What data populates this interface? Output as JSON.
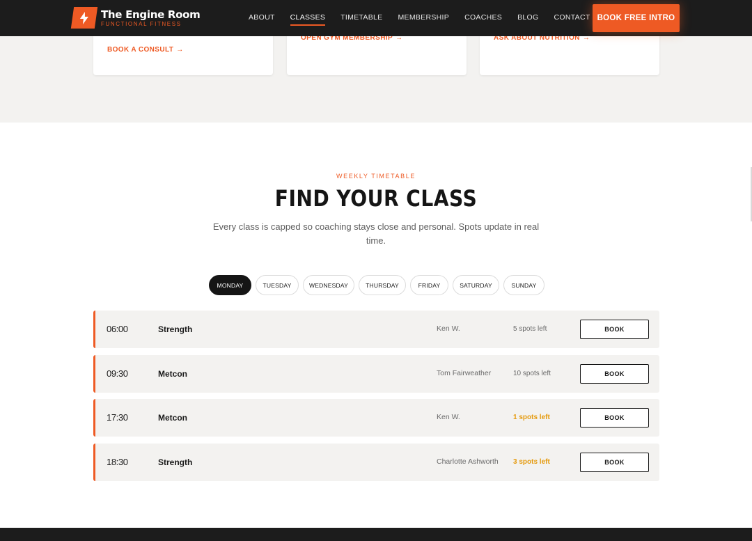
{
  "brand": {
    "name": "The Engine Room",
    "tagline": "FUNCTIONAL FITNESS",
    "accent_color": "#ee5a24"
  },
  "nav": {
    "items": [
      {
        "label": "ABOUT",
        "active": false
      },
      {
        "label": "CLASSES",
        "active": true
      },
      {
        "label": "TIMETABLE",
        "active": false
      },
      {
        "label": "MEMBERSHIP",
        "active": false
      },
      {
        "label": "COACHES",
        "active": false
      },
      {
        "label": "BLOG",
        "active": false
      },
      {
        "label": "CONTACT",
        "active": false
      }
    ],
    "cta_label": "BOOK FREE INTRO"
  },
  "cards": [
    {
      "link_label": "BOOK A CONSULT"
    },
    {
      "link_label": "OPEN GYM MEMBERSHIP"
    },
    {
      "link_label": "ASK ABOUT NUTRITION"
    }
  ],
  "timetable": {
    "eyebrow": "WEEKLY TIMETABLE",
    "title": "FIND YOUR CLASS",
    "subtitle": "Every class is capped so coaching stays close and personal. Spots update in real time.",
    "days": [
      "MONDAY",
      "TUESDAY",
      "WEDNESDAY",
      "THURSDAY",
      "FRIDAY",
      "SATURDAY",
      "SUNDAY"
    ],
    "selected_day": "MONDAY",
    "sessions": [
      {
        "time": "06:00",
        "class": "Strength",
        "coach": "Ken W.",
        "spots": "5 spots left",
        "low": false,
        "button": "BOOK"
      },
      {
        "time": "09:30",
        "class": "Metcon",
        "coach": "Tom Fairweather",
        "spots": "10 spots left",
        "low": false,
        "button": "BOOK"
      },
      {
        "time": "17:30",
        "class": "Metcon",
        "coach": "Ken W.",
        "spots": "1 spots left",
        "low": true,
        "button": "BOOK"
      },
      {
        "time": "18:30",
        "class": "Strength",
        "coach": "Charlotte Ashworth",
        "spots": "3 spots left",
        "low": true,
        "button": "BOOK"
      }
    ],
    "low_spots_color": "#e59a0c"
  }
}
